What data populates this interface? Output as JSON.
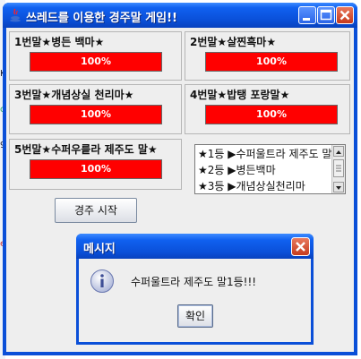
{
  "window": {
    "title": "쓰레드를 이용한 경주말 게임!!"
  },
  "horses": [
    {
      "label": "1번말★병든 백마★",
      "progress_text": "100%",
      "progress": 1.0
    },
    {
      "label": "2번말★살찐흑마★",
      "progress_text": "100%",
      "progress": 1.0
    },
    {
      "label": "3번말★개념상실 천리마★",
      "progress_text": "100%",
      "progress": 1.0
    },
    {
      "label": "4번말★밥탱 포랑말★",
      "progress_text": "100%",
      "progress": 1.0
    },
    {
      "label": "5번말★수퍼우릍라 제주도 말★",
      "progress_text": "100%",
      "progress": 1.0
    }
  ],
  "results": [
    "★1등 ▶수퍼울트라 제주도 말",
    "★2등 ▶병든백마",
    "★3등 ▶개념상실천리마"
  ],
  "start_button": "경주 시작",
  "dialog": {
    "title": "메시지",
    "message": "수퍼울트라 제주도 말1등!!!",
    "ok_label": "확인"
  },
  "colors": {
    "progress_fill": "#ff0000",
    "titlebar": "#0a4fd8"
  }
}
